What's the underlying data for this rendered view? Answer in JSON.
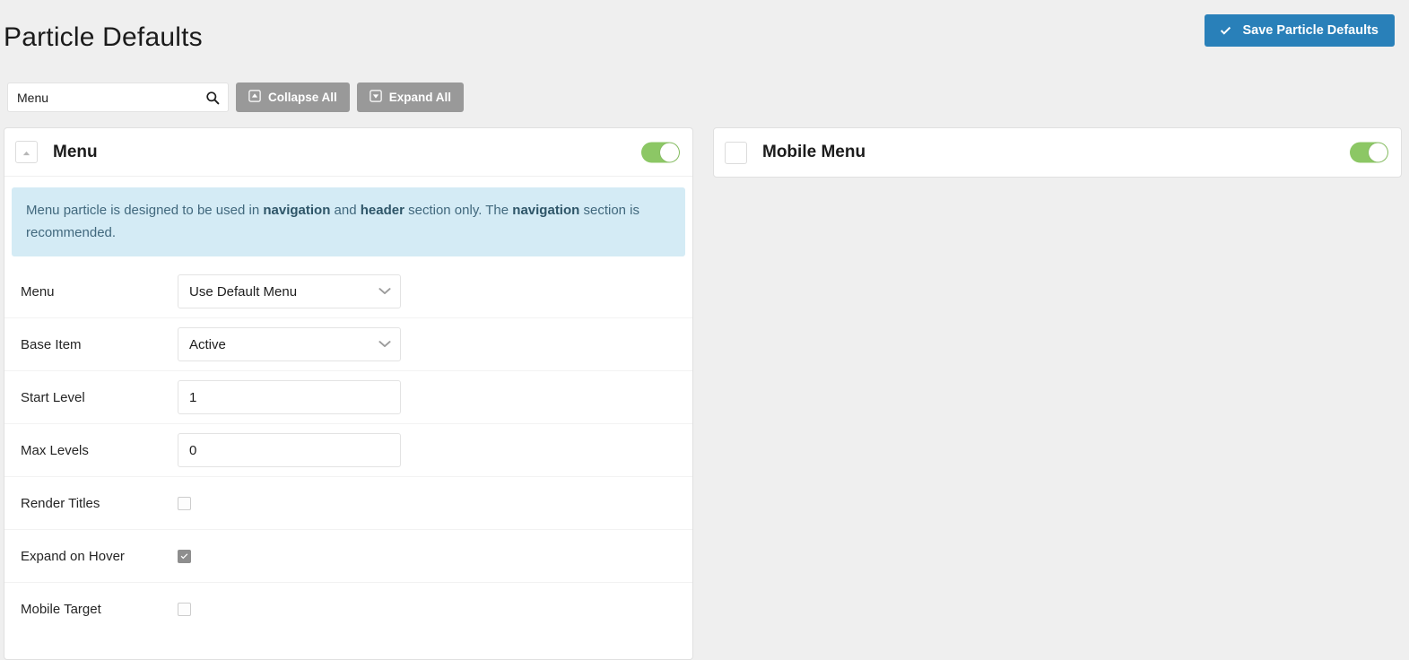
{
  "header": {
    "title": "Particle Defaults",
    "save_button": {
      "label": "Save Particle Defaults",
      "icon": "check-icon",
      "color": "#2980b9"
    }
  },
  "toolbar": {
    "search": {
      "value": "Menu",
      "placeholder": "Search",
      "icon": "search-icon"
    },
    "collapse_all": {
      "label": "Collapse All",
      "icon": "collapse-all-icon"
    },
    "expand_all": {
      "label": "Expand All",
      "icon": "expand-all-icon"
    }
  },
  "panels": [
    {
      "id": "menu",
      "title": "Menu",
      "collapse_icon": "caret-up-icon",
      "expanded": true,
      "enabled": true,
      "toggle_color": "#8cc765",
      "banner": {
        "text_parts": [
          {
            "text": "Menu particle is designed to be used in ",
            "bold": false
          },
          {
            "text": "navigation",
            "bold": true
          },
          {
            "text": " and ",
            "bold": false
          },
          {
            "text": "header",
            "bold": true
          },
          {
            "text": " section only. The ",
            "bold": false
          },
          {
            "text": "navigation",
            "bold": true
          },
          {
            "text": " section is recommended.",
            "bold": false
          }
        ],
        "background": "#d4ebf5"
      },
      "fields": [
        {
          "label": "Menu",
          "type": "select",
          "value": "Use Default Menu",
          "icon": "chevron-down-icon"
        },
        {
          "label": "Base Item",
          "type": "select",
          "value": "Active",
          "icon": "chevron-down-icon"
        },
        {
          "label": "Start Level",
          "type": "text",
          "value": "1"
        },
        {
          "label": "Max Levels",
          "type": "text",
          "value": "0"
        },
        {
          "label": "Render Titles",
          "type": "checkbox",
          "checked": false
        },
        {
          "label": "Expand on Hover",
          "type": "checkbox",
          "checked": true
        },
        {
          "label": "Mobile Target",
          "type": "checkbox",
          "checked": false
        }
      ]
    },
    {
      "id": "mobile-menu",
      "title": "Mobile Menu",
      "collapse_icon": "",
      "expanded": false,
      "enabled": true,
      "toggle_color": "#8cc765",
      "fields": []
    }
  ]
}
